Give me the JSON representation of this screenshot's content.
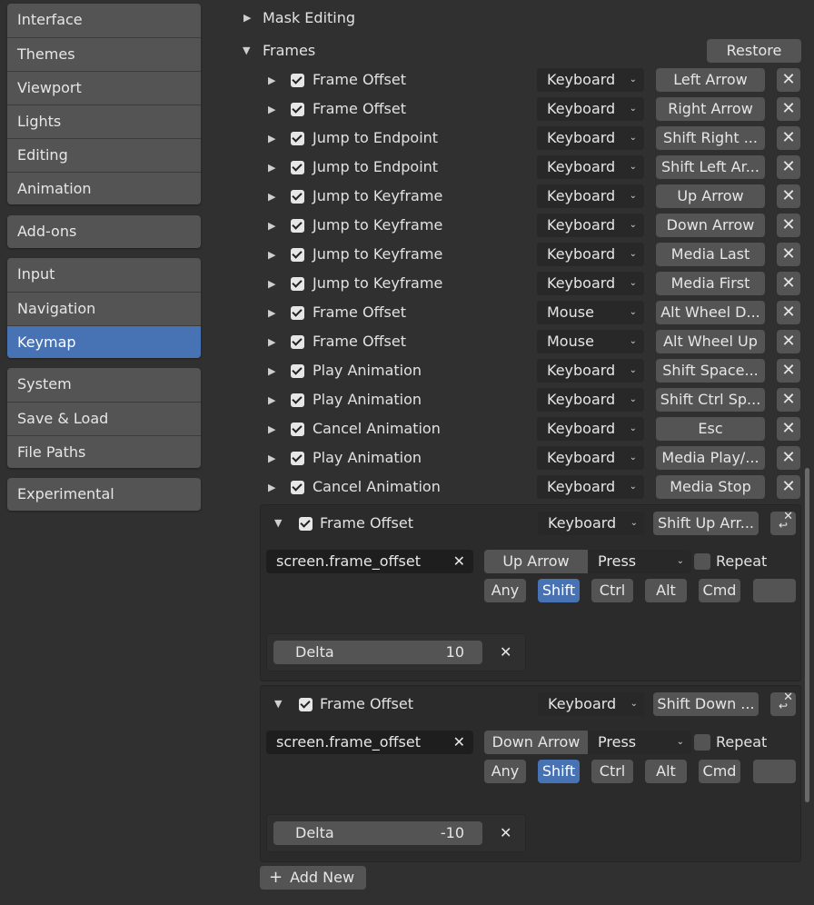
{
  "sidebar": {
    "groups": [
      {
        "items": [
          "Interface",
          "Themes",
          "Viewport",
          "Lights",
          "Editing",
          "Animation"
        ]
      },
      {
        "items": [
          "Add-ons"
        ]
      },
      {
        "items": [
          "Input",
          "Navigation",
          "Keymap"
        ]
      },
      {
        "items": [
          "System",
          "Save & Load",
          "File Paths"
        ]
      },
      {
        "items": [
          "Experimental"
        ]
      }
    ],
    "active": "Keymap",
    "accent_color": "#4772b3"
  },
  "sections": {
    "mask_editing": "Mask Editing",
    "frames": "Frames",
    "restore_label": "Restore"
  },
  "keymap_items": [
    {
      "name": "Frame Offset",
      "enabled": true,
      "input": "Keyboard",
      "key": "Left Arrow"
    },
    {
      "name": "Frame Offset",
      "enabled": true,
      "input": "Keyboard",
      "key": "Right Arrow"
    },
    {
      "name": "Jump to Endpoint",
      "enabled": true,
      "input": "Keyboard",
      "key": "Shift Right ..."
    },
    {
      "name": "Jump to Endpoint",
      "enabled": true,
      "input": "Keyboard",
      "key": "Shift Left Ar..."
    },
    {
      "name": "Jump to Keyframe",
      "enabled": true,
      "input": "Keyboard",
      "key": "Up Arrow"
    },
    {
      "name": "Jump to Keyframe",
      "enabled": true,
      "input": "Keyboard",
      "key": "Down Arrow"
    },
    {
      "name": "Jump to Keyframe",
      "enabled": true,
      "input": "Keyboard",
      "key": "Media Last"
    },
    {
      "name": "Jump to Keyframe",
      "enabled": true,
      "input": "Keyboard",
      "key": "Media First"
    },
    {
      "name": "Frame Offset",
      "enabled": true,
      "input": "Mouse",
      "key": "Alt Wheel D..."
    },
    {
      "name": "Frame Offset",
      "enabled": true,
      "input": "Mouse",
      "key": "Alt Wheel Up"
    },
    {
      "name": "Play Animation",
      "enabled": true,
      "input": "Keyboard",
      "key": "Shift Space..."
    },
    {
      "name": "Play Animation",
      "enabled": true,
      "input": "Keyboard",
      "key": "Shift Ctrl Sp..."
    },
    {
      "name": "Cancel Animation",
      "enabled": true,
      "input": "Keyboard",
      "key": "Esc"
    },
    {
      "name": "Play Animation",
      "enabled": true,
      "input": "Keyboard",
      "key": "Media Play/..."
    },
    {
      "name": "Cancel Animation",
      "enabled": true,
      "input": "Keyboard",
      "key": "Media Stop"
    }
  ],
  "expanded_items": [
    {
      "name": "Frame Offset",
      "enabled": true,
      "input": "Keyboard",
      "key": "Shift Up Arr...",
      "operator": "screen.frame_offset",
      "key_name": "Up Arrow",
      "event": "Press",
      "repeat_label": "Repeat",
      "modifiers": [
        "Any",
        "Shift",
        "Ctrl",
        "Alt",
        "Cmd"
      ],
      "active_modifier": "Shift",
      "prop_name": "Delta",
      "prop_value": "10"
    },
    {
      "name": "Frame Offset",
      "enabled": true,
      "input": "Keyboard",
      "key": "Shift Down ...",
      "operator": "screen.frame_offset",
      "key_name": "Down Arrow",
      "event": "Press",
      "repeat_label": "Repeat",
      "modifiers": [
        "Any",
        "Shift",
        "Ctrl",
        "Alt",
        "Cmd"
      ],
      "active_modifier": "Shift",
      "prop_name": "Delta",
      "prop_value": "-10"
    }
  ],
  "add_new_label": "Add New",
  "icons": {
    "expand": "triangle-right-icon",
    "collapse": "triangle-down-icon",
    "remove": "x-icon",
    "restore": "undo-icon",
    "add": "plus-icon"
  }
}
